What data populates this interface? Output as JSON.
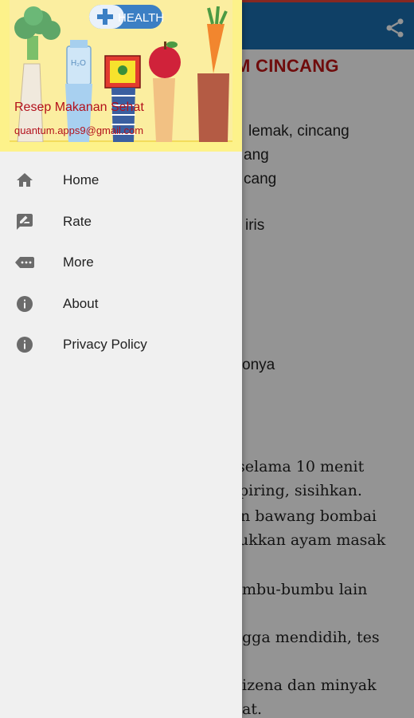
{
  "background_article": {
    "title_fragment": "M CINCANG",
    "lines": [
      "lemak, cincang",
      "ang",
      "cang",
      "iris",
      "onya",
      "selama 10 menit",
      "piring, sisihkan.",
      "n bawang bombai",
      "ukkan ayam masak",
      "mbu-bumbu lain",
      "gga mendidih, tes",
      "izena dan minyak",
      "at."
    ]
  },
  "appbar": {
    "share_icon": "share-icon"
  },
  "drawer": {
    "header": {
      "app_name": "Resep Makanan Sehat",
      "email": "quantum.apps9@gmail.com",
      "badge_text": "HEALTH",
      "bottle_text": "H₂O"
    },
    "menu": [
      {
        "label": "Home",
        "icon": "home-icon"
      },
      {
        "label": "Rate",
        "icon": "rate-icon"
      },
      {
        "label": "More",
        "icon": "more-icon"
      },
      {
        "label": "About",
        "icon": "info-icon"
      },
      {
        "label": "Privacy Policy",
        "icon": "info-icon"
      }
    ]
  },
  "colors": {
    "appbar": "#1a6fb0",
    "header_bg": "#fdf28a",
    "header_text": "#b3101b",
    "drawer_bg": "#f0f0f0",
    "title_red": "#c01616"
  }
}
